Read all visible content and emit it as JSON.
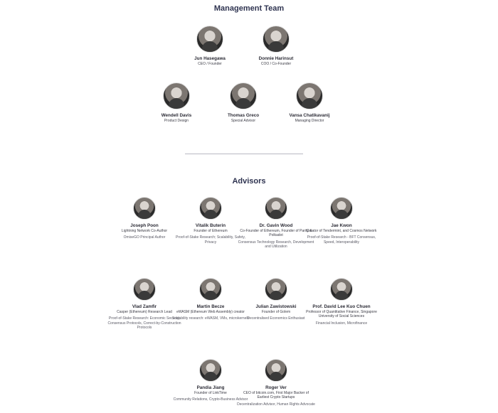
{
  "management": {
    "title": "Management Team",
    "people": [
      {
        "name": "Jun Hasegawa",
        "role": "CEO / Founder"
      },
      {
        "name": "Donnie Harinsut",
        "role": "COO / Co-Founder"
      },
      {
        "name": "Wendell Davis",
        "role": "Product Design"
      },
      {
        "name": "Thomas Greco",
        "role": "Special Advisor"
      },
      {
        "name": "Vansa Chatikavanij",
        "role": "Managing Director"
      }
    ]
  },
  "advisors": {
    "title": "Advisors",
    "people": [
      {
        "name": "Joseph Poon",
        "role": "Lightning Network Co-Author",
        "note": "OmiseGO Principal Author"
      },
      {
        "name": "Vitalik Buterin",
        "role": "Founder of Ethereum",
        "note": "Proof-of-Stake Research; Scalability, Safety, Privacy"
      },
      {
        "name": "Dr. Gavin Wood",
        "role": "Co-Founder of Ethereum, Founder of Parity & Polkadot",
        "note": "Consensus Technology Research, Development and Utilization"
      },
      {
        "name": "Jae Kwon",
        "role": "Creator of Tendermint, and Cosmos Network",
        "note": "Proof-of-Stake Research - BFT Consensus, Speed, Interoperability"
      },
      {
        "name": "Vlad Zamfir",
        "role": "Casper (Ethereum) Research Lead",
        "note": "Proof-of-Stake Research: Economic Security, Consensus Protocols, Correct-by-Construction Protocols"
      },
      {
        "name": "Martin Becze",
        "role": "eWASM (Ethereum Web Assembly) creator",
        "note": "Scalability research: eWASM, VMs, microkernels"
      },
      {
        "name": "Julian Zawistowski",
        "role": "Founder of Golem",
        "note": "Decentralised Economics Enthusiast"
      },
      {
        "name": "Prof. David Lee Kuo Chuen",
        "role": "Professor of Quantitative Finance, Singapore University of Social Sciences",
        "note": "Financial Inclusion, Microfinance"
      },
      {
        "name": "Pandia Jiang",
        "role": "Founder of LinkTime",
        "note": "Community Relations, Crypto-Business Advisor"
      },
      {
        "name": "Roger Ver",
        "role": "CEO of bitcoin.com, First Major Backer of Earliest Crypto Startups",
        "note": "Decentralization Advisor, Human Rights Advocate"
      }
    ]
  }
}
